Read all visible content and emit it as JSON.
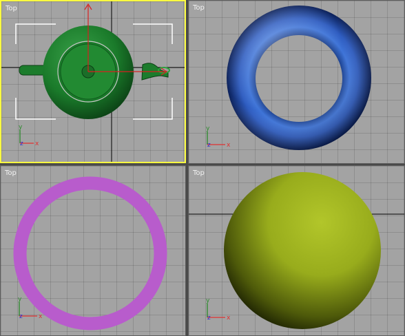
{
  "viewports": [
    {
      "label": "Top",
      "active": true,
      "object": "teapot",
      "color": "#1e7a2e"
    },
    {
      "label": "Top",
      "active": false,
      "object": "torus",
      "color": "#2f5fc8"
    },
    {
      "label": "Top",
      "active": false,
      "object": "ring",
      "color": "#b85ccc"
    },
    {
      "label": "Top",
      "active": false,
      "object": "sphere",
      "color": "#a7b824"
    }
  ],
  "axis_labels": {
    "x": "x",
    "y": "y",
    "z": "z"
  },
  "colors": {
    "active_border": "#ffff40",
    "viewport_bg": "#a3a3a3",
    "frame": "#4a4a4a"
  }
}
